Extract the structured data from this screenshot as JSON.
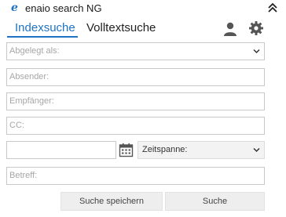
{
  "app": {
    "logo": "e",
    "title": "enaio search NG"
  },
  "tabs": [
    {
      "label": "Indexsuche",
      "active": true
    },
    {
      "label": "Volltextsuche",
      "active": false
    }
  ],
  "icons": {
    "collapse": "double-chevron-up-icon",
    "user": "user-icon",
    "settings": "gear-icon",
    "calendar": "calendar-icon",
    "dropdown": "chevron-down-icon"
  },
  "form": {
    "ablage_placeholder": "Abgelegt als:",
    "absender_placeholder": "Absender:",
    "empfaenger_placeholder": "Empfänger:",
    "cc_placeholder": "CC:",
    "date_value": "",
    "zeitspanne_value": "Zeitspanne:",
    "betreff_placeholder": "Betreff:"
  },
  "buttons": {
    "save": "Suche speichern",
    "search": "Suche"
  },
  "colors": {
    "accent": "#1e73c4",
    "icon": "#555555"
  }
}
